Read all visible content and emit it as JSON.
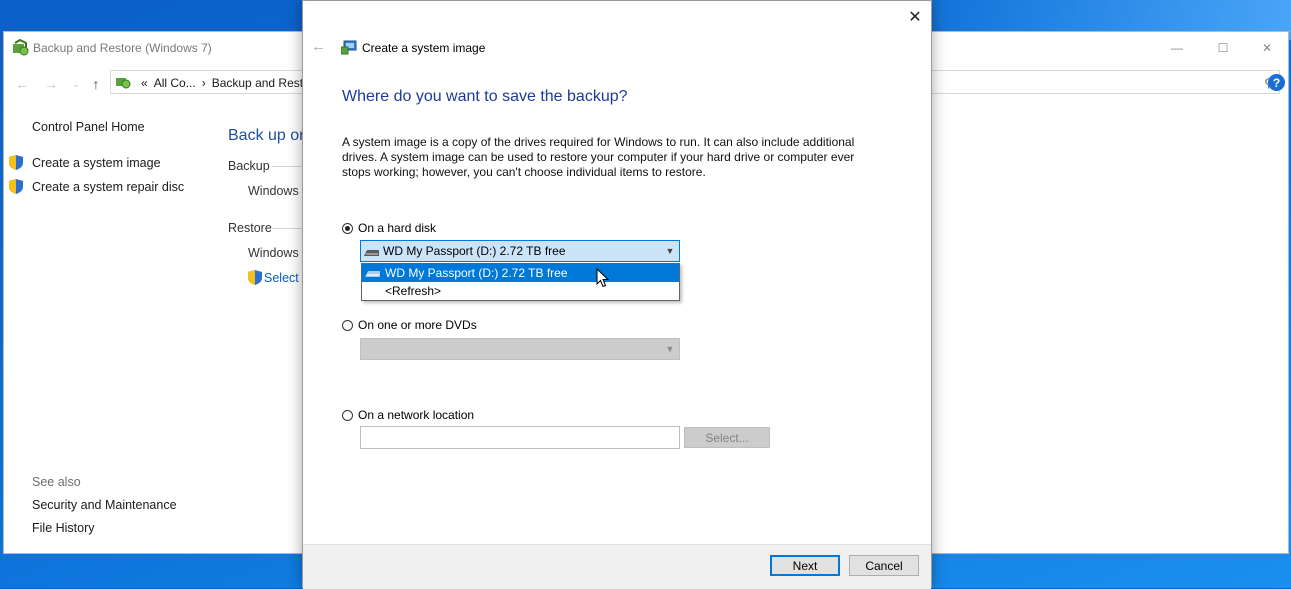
{
  "background_window": {
    "title": "Backup and Restore (Windows 7)",
    "controls": {
      "minimize": "—",
      "maximize": "☐",
      "close": "✕"
    },
    "address": {
      "overflow": "«",
      "crumb1": "All Co...",
      "sep": "›",
      "crumb2": "Backup and Resto"
    },
    "help": "?",
    "left_pane": {
      "home": "Control Panel Home",
      "create_image": "Create a system image",
      "create_disc": "Create a system repair disc",
      "see_also": "See also",
      "security": "Security and Maintenance",
      "file_history": "File History"
    },
    "main": {
      "heading": "Back up or",
      "backup_label": "Backup",
      "backup_value": "Windows B",
      "restore_label": "Restore",
      "restore_value": "Windows c",
      "select_link": "Select a"
    }
  },
  "dialog": {
    "close": "✕",
    "title": "Create a system image",
    "heading": "Where do you want to save the backup?",
    "description": "A system image is a copy of the drives required for Windows to run. It can also include additional drives. A system image can be used to restore your computer if your hard drive or computer ever stops working; however, you can't choose individual items to restore.",
    "options": {
      "hard_disk": "On a hard disk",
      "dvds": "On one or more DVDs",
      "network": "On a network location"
    },
    "hard_disk_selected": "WD My Passport (D:)  2.72 TB free",
    "dropdown_items": [
      "WD My Passport (D:)  2.72 TB free",
      "<Refresh>"
    ],
    "network_path": "",
    "select_button": "Select...",
    "next_button": "Next",
    "cancel_button": "Cancel"
  },
  "colors": {
    "accent": "#0078d7",
    "heading": "#1b3b9a",
    "desktop": "#0a63c9"
  }
}
